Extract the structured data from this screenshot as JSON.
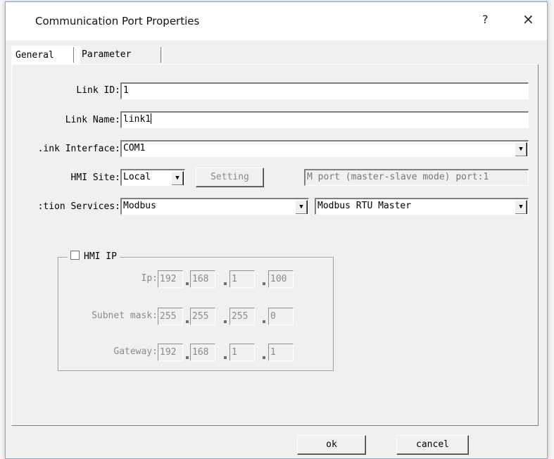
{
  "window": {
    "title": "Communication Port Properties",
    "help": "?",
    "close": "×"
  },
  "tabs": [
    {
      "label": "General"
    },
    {
      "label": "Parameter"
    }
  ],
  "form": {
    "link_id": {
      "label": "Link ID:",
      "value": "1"
    },
    "link_name": {
      "label": "Link Name:",
      "value": "link1"
    },
    "link_interface": {
      "label": ".ink Interface:",
      "value": "COM1"
    },
    "hmi_site": {
      "label": "HMI Site:",
      "value": "Local",
      "setting_label": "Setting",
      "info": "M port (master-slave mode) port:1"
    },
    "services": {
      "label": ":tion Services:",
      "protocol": "Modbus",
      "mode": "Modbus RTU Master"
    }
  },
  "hmi_ip": {
    "label": "HMI IP",
    "checked": false,
    "ip": {
      "label": "Ip:",
      "octets": [
        "192",
        "168",
        "1",
        "100"
      ]
    },
    "subnet": {
      "label": "Subnet mask:",
      "octets": [
        "255",
        "255",
        "255",
        "0"
      ]
    },
    "gateway": {
      "label": "Gateway:",
      "octets": [
        "192",
        "168",
        "1",
        "1"
      ]
    }
  },
  "buttons": {
    "ok": "ok",
    "cancel": "cancel"
  }
}
